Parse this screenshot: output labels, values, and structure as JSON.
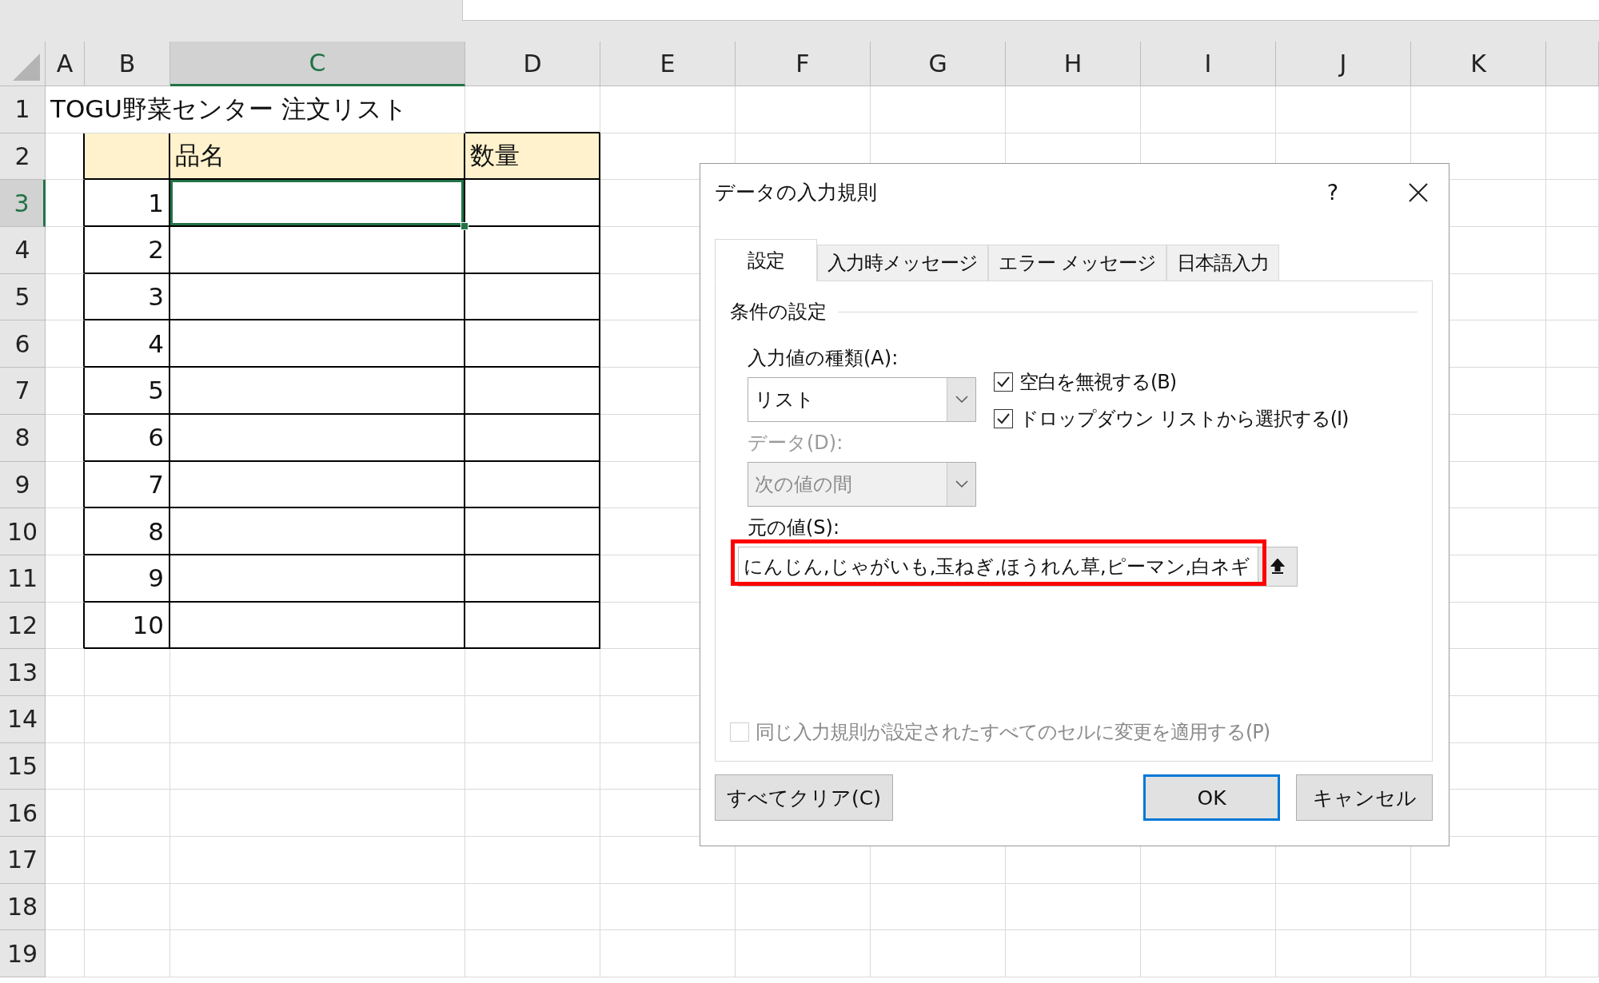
{
  "sheet": {
    "columns": [
      {
        "label": "A",
        "selected": false
      },
      {
        "label": "B",
        "selected": false
      },
      {
        "label": "C",
        "selected": true
      },
      {
        "label": "D",
        "selected": false
      },
      {
        "label": "E",
        "selected": false
      },
      {
        "label": "F",
        "selected": false
      },
      {
        "label": "G",
        "selected": false
      },
      {
        "label": "H",
        "selected": false
      },
      {
        "label": "I",
        "selected": false
      },
      {
        "label": "J",
        "selected": false
      },
      {
        "label": "K",
        "selected": false
      }
    ],
    "rows": [
      {
        "label": "1",
        "selected": false
      },
      {
        "label": "2",
        "selected": false
      },
      {
        "label": "3",
        "selected": true
      },
      {
        "label": "4",
        "selected": false
      },
      {
        "label": "5",
        "selected": false
      },
      {
        "label": "6",
        "selected": false
      },
      {
        "label": "7",
        "selected": false
      },
      {
        "label": "8",
        "selected": false
      },
      {
        "label": "9",
        "selected": false
      },
      {
        "label": "10",
        "selected": false
      },
      {
        "label": "11",
        "selected": false
      },
      {
        "label": "12",
        "selected": false
      },
      {
        "label": "13",
        "selected": false
      },
      {
        "label": "14",
        "selected": false
      },
      {
        "label": "15",
        "selected": false
      },
      {
        "label": "16",
        "selected": false
      },
      {
        "label": "17",
        "selected": false
      },
      {
        "label": "18",
        "selected": false
      },
      {
        "label": "19",
        "selected": false
      }
    ],
    "title": "TOGU野菜センター 注文リスト",
    "table": {
      "header": [
        "品名",
        "数量"
      ],
      "rows": [
        {
          "number": "1",
          "selected": true
        },
        {
          "number": "2",
          "selected": false
        },
        {
          "number": "3",
          "selected": false
        },
        {
          "number": "4",
          "selected": false
        },
        {
          "number": "5",
          "selected": false
        },
        {
          "number": "6",
          "selected": false
        },
        {
          "number": "7",
          "selected": false
        },
        {
          "number": "8",
          "selected": false
        },
        {
          "number": "9",
          "selected": false
        },
        {
          "number": "10",
          "selected": false
        }
      ]
    }
  },
  "dialog": {
    "title": "データの入力規則",
    "help": "?",
    "tabs": [
      {
        "label": "設定",
        "selected": true
      },
      {
        "label": "入力時メッセージ",
        "selected": false
      },
      {
        "label": "エラー メッセージ",
        "selected": false
      },
      {
        "label": "日本語入力",
        "selected": false
      }
    ],
    "section": "条件の設定",
    "allow": {
      "label": "入力値の種類(A):",
      "value": "リスト",
      "disabled": false
    },
    "data": {
      "label": "データ(D):",
      "value": "次の値の間",
      "disabled": true
    },
    "checkboxes": [
      {
        "label": "空白を無視する(B)",
        "checked": true
      },
      {
        "label": "ドロップダウン リストから選択する(I)",
        "checked": true
      }
    ],
    "source": {
      "label": "元の値(S):",
      "value": "にんじん,じゃがいも,玉ねぎ,ほうれん草,ピーマン,白ネギ",
      "highlighted": true
    },
    "apply": {
      "label": "同じ入力規則が設定されたすべてのセルに変更を適用する(P)",
      "checked": false,
      "disabled": true
    },
    "buttons": [
      {
        "label": "すべてクリア(C)",
        "kind": "clear",
        "default": false
      },
      {
        "label": "OK",
        "kind": "action",
        "default": true
      },
      {
        "label": "キャンセル",
        "kind": "action",
        "default": false
      }
    ]
  }
}
